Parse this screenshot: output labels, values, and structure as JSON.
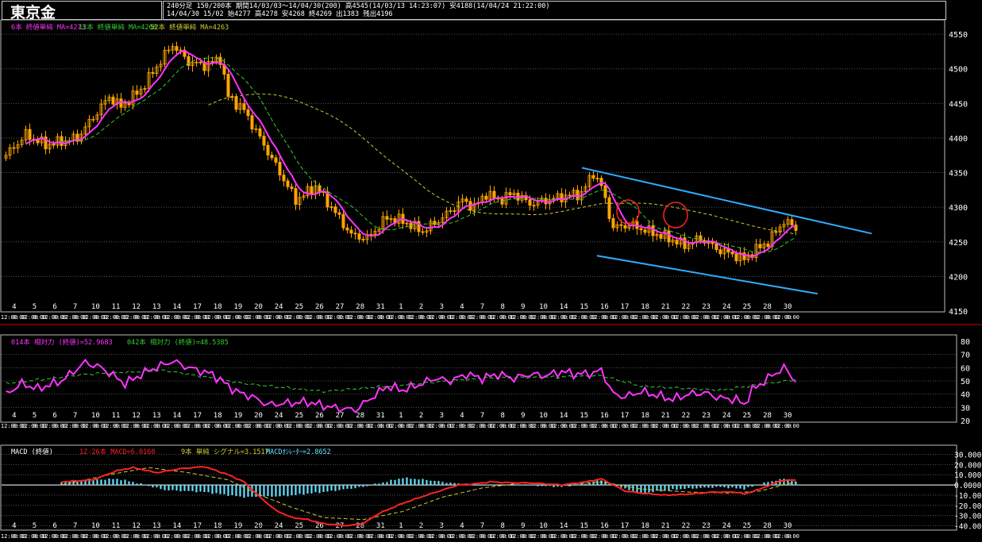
{
  "header": {
    "title": "東京金",
    "info_line1": "240分足 150/200本 期間14/03/03〜14/04/30(200) 高4545(14/03/13 14:23:07) 安4188(14/04/24 21:22:00)",
    "info_line2": "14/04/30 15/02 始4277 高4278 安4268 終4269 出1383 残出4196"
  },
  "colors": {
    "background": "#000000",
    "price_candle": "#ffa500",
    "ma6": "#ff33ff",
    "ma13": "#33cc33",
    "ma52": "#cccc33",
    "channel": "#33aaff",
    "circles": "#ff2222",
    "macd": "#ff2222",
    "signal": "#cccc33",
    "histogram": "#66e0ff",
    "rsi14": "#ff33ff",
    "rsi42": "#33cc33"
  },
  "chart_data": [
    {
      "type": "line",
      "panel": "price",
      "legend": {
        "ma6": "6本 終値単純 MA=4273",
        "ma13": "13本 終値単純 MA=4268",
        "ma52": "52本 終値単純 MA=4263"
      },
      "ylim": [
        4150,
        4565
      ],
      "yticks": [
        4150,
        4200,
        4250,
        4300,
        4350,
        4400,
        4450,
        4500,
        4550
      ],
      "day_labels": [
        "4",
        "5",
        "6",
        "7",
        "10",
        "11",
        "12",
        "13",
        "14",
        "17",
        "18",
        "19",
        "20",
        "24",
        "25",
        "26",
        "27",
        "28",
        "31",
        "1",
        "2",
        "3",
        "4",
        "7",
        "8",
        "9",
        "10",
        "14",
        "15",
        "16",
        "17",
        "18",
        "21",
        "22",
        "23",
        "24",
        "25",
        "28",
        "30"
      ],
      "time_labels": [
        "12:00",
        "8:00"
      ],
      "close_keypoints": [
        [
          0,
          4375
        ],
        [
          5,
          4405
        ],
        [
          10,
          4390
        ],
        [
          18,
          4400
        ],
        [
          26,
          4460
        ],
        [
          29,
          4445
        ],
        [
          34,
          4470
        ],
        [
          40,
          4520
        ],
        [
          42,
          4535
        ],
        [
          46,
          4510
        ],
        [
          50,
          4505
        ],
        [
          54,
          4515
        ],
        [
          56,
          4460
        ],
        [
          60,
          4440
        ],
        [
          64,
          4400
        ],
        [
          68,
          4360
        ],
        [
          73,
          4310
        ],
        [
          78,
          4330
        ],
        [
          82,
          4300
        ],
        [
          87,
          4260
        ],
        [
          91,
          4255
        ],
        [
          96,
          4285
        ],
        [
          100,
          4280
        ],
        [
          105,
          4265
        ],
        [
          110,
          4285
        ],
        [
          115,
          4310
        ],
        [
          118,
          4300
        ],
        [
          121,
          4320
        ],
        [
          124,
          4310
        ],
        [
          128,
          4320
        ],
        [
          132,
          4305
        ],
        [
          136,
          4310
        ],
        [
          140,
          4315
        ],
        [
          145,
          4320
        ],
        [
          148,
          4350
        ],
        [
          150,
          4330
        ],
        [
          153,
          4270
        ],
        [
          157,
          4275
        ],
        [
          162,
          4265
        ],
        [
          167,
          4255
        ],
        [
          171,
          4245
        ],
        [
          175,
          4255
        ],
        [
          179,
          4240
        ],
        [
          183,
          4232
        ],
        [
          186,
          4225
        ],
        [
          188,
          4235
        ],
        [
          192,
          4250
        ],
        [
          196,
          4280
        ],
        [
          199,
          4270
        ]
      ],
      "channel_upper": [
        [
          0,
          4357
        ],
        [
          1,
          4262
        ]
      ],
      "channel_lower": [
        [
          0,
          4230
        ],
        [
          1,
          4175
        ]
      ]
    },
    {
      "type": "line",
      "panel": "rsi",
      "legend": {
        "rsi14": "014本 相対力 (終値)=52.9683",
        "rsi42": "042本 相対力 (終値)=48.5385"
      },
      "ylim": [
        20,
        80
      ],
      "yticks": [
        20,
        30,
        40,
        50,
        60,
        70,
        80
      ],
      "rsi14_keypoints": [
        [
          0,
          40
        ],
        [
          4,
          48
        ],
        [
          8,
          44
        ],
        [
          14,
          50
        ],
        [
          20,
          64
        ],
        [
          24,
          60
        ],
        [
          30,
          48
        ],
        [
          36,
          58
        ],
        [
          42,
          65
        ],
        [
          46,
          60
        ],
        [
          52,
          55
        ],
        [
          58,
          42
        ],
        [
          62,
          38
        ],
        [
          66,
          32
        ],
        [
          70,
          33
        ],
        [
          76,
          34
        ],
        [
          82,
          30
        ],
        [
          88,
          28
        ],
        [
          92,
          37
        ],
        [
          96,
          46
        ],
        [
          100,
          43
        ],
        [
          104,
          47
        ],
        [
          108,
          52
        ],
        [
          112,
          50
        ],
        [
          116,
          55
        ],
        [
          120,
          52
        ],
        [
          124,
          55
        ],
        [
          128,
          52
        ],
        [
          132,
          55
        ],
        [
          136,
          54
        ],
        [
          140,
          57
        ],
        [
          144,
          55
        ],
        [
          148,
          56
        ],
        [
          150,
          58
        ],
        [
          153,
          40
        ],
        [
          156,
          38
        ],
        [
          160,
          42
        ],
        [
          164,
          39
        ],
        [
          168,
          36
        ],
        [
          172,
          40
        ],
        [
          176,
          41
        ],
        [
          180,
          37
        ],
        [
          184,
          36
        ],
        [
          186,
          32
        ],
        [
          188,
          43
        ],
        [
          192,
          52
        ],
        [
          196,
          60
        ],
        [
          199,
          50
        ]
      ],
      "rsi42_keypoints": [
        [
          0,
          48
        ],
        [
          20,
          55
        ],
        [
          40,
          58
        ],
        [
          60,
          48
        ],
        [
          80,
          42
        ],
        [
          100,
          47
        ],
        [
          120,
          52
        ],
        [
          140,
          53
        ],
        [
          150,
          54
        ],
        [
          160,
          46
        ],
        [
          180,
          43
        ],
        [
          199,
          51
        ]
      ]
    },
    {
      "type": "line",
      "panel": "macd",
      "legend": {
        "macd": "12-26本 MACD=6.0168",
        "signal": "9本 単純 シグナル=3.1517",
        "hist": "MACDｵｼﾚｰﾀｰ=2.8652"
      },
      "title": "MACD (終値)",
      "ylim": [
        -42,
        32
      ],
      "yticks": [
        -40,
        -30,
        -20,
        -10,
        0,
        10,
        20,
        30
      ],
      "macd_keypoints": [
        [
          14,
          3
        ],
        [
          22,
          5
        ],
        [
          28,
          14
        ],
        [
          32,
          17
        ],
        [
          38,
          12
        ],
        [
          44,
          16
        ],
        [
          50,
          18
        ],
        [
          56,
          10
        ],
        [
          60,
          3
        ],
        [
          64,
          -12
        ],
        [
          68,
          -25
        ],
        [
          72,
          -32
        ],
        [
          76,
          -34
        ],
        [
          80,
          -38
        ],
        [
          86,
          -40
        ],
        [
          90,
          -38
        ],
        [
          94,
          -28
        ],
        [
          100,
          -18
        ],
        [
          106,
          -10
        ],
        [
          110,
          -5
        ],
        [
          114,
          0
        ],
        [
          118,
          1
        ],
        [
          122,
          3
        ],
        [
          128,
          2
        ],
        [
          132,
          2
        ],
        [
          140,
          0
        ],
        [
          146,
          3
        ],
        [
          150,
          6
        ],
        [
          153,
          0
        ],
        [
          156,
          -6
        ],
        [
          160,
          -8
        ],
        [
          166,
          -10
        ],
        [
          172,
          -9
        ],
        [
          178,
          -7
        ],
        [
          184,
          -7
        ],
        [
          186,
          -9
        ],
        [
          190,
          -4
        ],
        [
          195,
          4
        ],
        [
          199,
          5
        ]
      ],
      "signal_keypoints": [
        [
          14,
          0
        ],
        [
          26,
          10
        ],
        [
          36,
          17
        ],
        [
          46,
          12
        ],
        [
          56,
          5
        ],
        [
          64,
          -10
        ],
        [
          72,
          -22
        ],
        [
          80,
          -32
        ],
        [
          90,
          -34
        ],
        [
          100,
          -26
        ],
        [
          110,
          -12
        ],
        [
          120,
          -3
        ],
        [
          130,
          2
        ],
        [
          140,
          0
        ],
        [
          150,
          3
        ],
        [
          160,
          -4
        ],
        [
          172,
          -7
        ],
        [
          182,
          -8
        ],
        [
          190,
          -6
        ],
        [
          199,
          3
        ]
      ],
      "hist_keypoints": [
        [
          14,
          3
        ],
        [
          22,
          5
        ],
        [
          28,
          6
        ],
        [
          32,
          3
        ],
        [
          40,
          -5
        ],
        [
          50,
          -7
        ],
        [
          60,
          -12
        ],
        [
          70,
          -11
        ],
        [
          80,
          -7
        ],
        [
          90,
          -2
        ],
        [
          100,
          7
        ],
        [
          106,
          5
        ],
        [
          112,
          2
        ],
        [
          120,
          0
        ],
        [
          130,
          0
        ],
        [
          140,
          -2
        ],
        [
          148,
          3
        ],
        [
          150,
          5
        ],
        [
          156,
          -4
        ],
        [
          160,
          -8
        ],
        [
          170,
          -4
        ],
        [
          180,
          -2
        ],
        [
          186,
          -4
        ],
        [
          192,
          3
        ],
        [
          196,
          6
        ],
        [
          199,
          3
        ]
      ]
    }
  ]
}
